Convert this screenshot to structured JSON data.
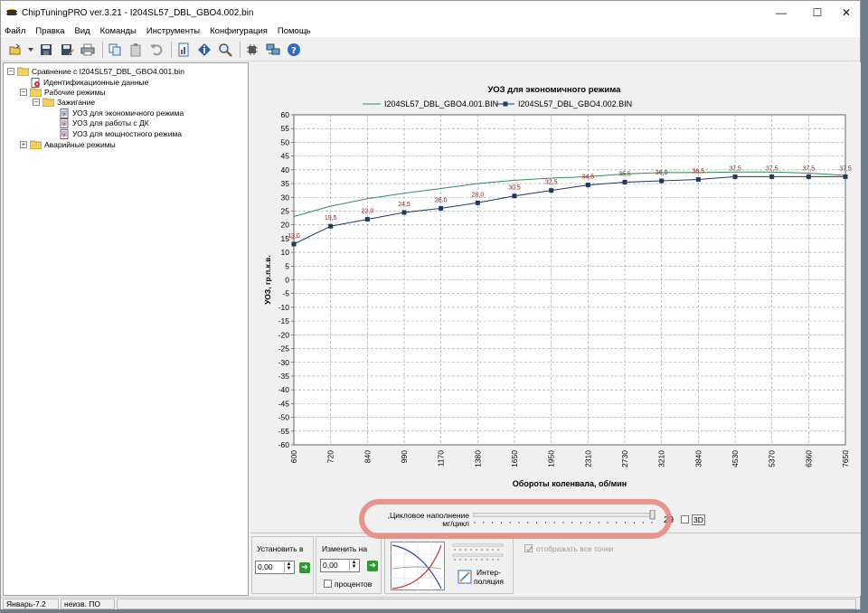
{
  "window": {
    "title": "ChipTuningPRO ver.3.21 - I204SL57_DBL_GBO4.002.bin"
  },
  "menu": [
    "Файл",
    "Правка",
    "Вид",
    "Команды",
    "Инструменты",
    "Конфигурация",
    "Помощь"
  ],
  "tree": {
    "root": "Сравнение с I204SL57_DBL_GBO4.001.bin",
    "id_data": "Идентификационные данные",
    "work_modes": "Рабочие режимы",
    "ignition": "Зажигание",
    "map_economy": "УОЗ для экономичного режима",
    "map_dk": "УОЗ для работы с ДК",
    "map_power": "УОЗ для мощностного режима",
    "emergency": "Аварийные режимы"
  },
  "chart_data": {
    "type": "line",
    "title": "УОЗ для экономичного режима",
    "xlabel": "Обороты коленвала, об/мин",
    "ylabel": "УОЗ, гр.п.к.в.",
    "ylim": [
      -60,
      60
    ],
    "y_ticks": [
      60,
      55,
      50,
      45,
      40,
      35,
      30,
      25,
      20,
      15,
      10,
      5,
      0,
      -5,
      -10,
      -15,
      -20,
      -25,
      -30,
      -35,
      -40,
      -45,
      -50,
      -55,
      -60
    ],
    "x": [
      "600",
      "720",
      "840",
      "990",
      "1170",
      "1380",
      "1650",
      "1950",
      "2310",
      "2730",
      "3210",
      "3840",
      "4530",
      "5370",
      "6360",
      "7650"
    ],
    "grid": true,
    "legend_position": "top",
    "series": [
      {
        "name": "I204SL57_DBL_GBO4.001.BIN",
        "color": "#2e8b57",
        "marker": "none",
        "values": [
          23.0,
          26.8,
          29.5,
          31.5,
          33.2,
          35.0,
          36.2,
          37.0,
          37.5,
          38.5,
          39.0,
          39.0,
          39.2,
          39.2,
          38.8,
          38.0
        ]
      },
      {
        "name": "I204SL57_DBL_GBO4.002.BIN",
        "color": "#1f3864",
        "marker": "square",
        "values": [
          13.0,
          19.5,
          22.0,
          24.5,
          26.0,
          28.0,
          30.5,
          32.5,
          34.5,
          35.5,
          36.0,
          36.5,
          37.5,
          37.5,
          37.5,
          37.5
        ],
        "labels": [
          "13,0",
          "19,5",
          "22,0",
          "24,5",
          "26,0",
          "28,0",
          "30,5",
          "32,5",
          "34,5",
          "35,5",
          "36,0",
          "36,5",
          "37,5",
          "37,5",
          "37,5",
          "37,5"
        ]
      }
    ]
  },
  "slider": {
    "label_line1": "Цикловое наполнение,",
    "label_line2": "мг/цикл",
    "value": "29",
    "fraction": 1.0,
    "three_d_label": "3D"
  },
  "bottom": {
    "set_label": "Установить в",
    "set_value": "0,00",
    "change_label": "Изменить на",
    "change_value": "0,00",
    "percent_label": "процентов",
    "interp_line1": "Интер-",
    "interp_line2": "поляция",
    "show_all_points": "отображать все точки"
  },
  "status": {
    "cell1": "Январь-7.2",
    "cell2": "неизв. ПО"
  },
  "colors": {
    "accent_highlight": "#e8897f",
    "data_label": "#8b1a1a",
    "go_button": "#2d9a2d"
  }
}
